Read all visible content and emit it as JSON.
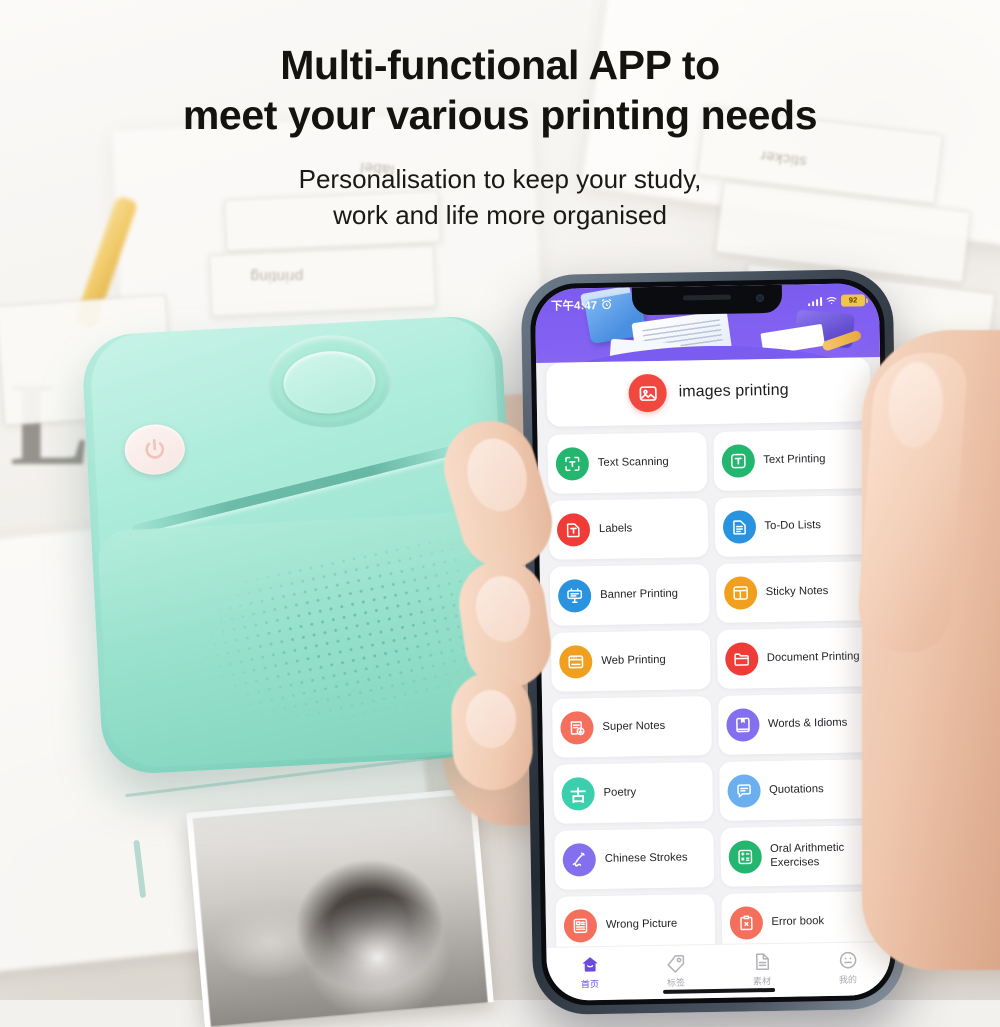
{
  "headline": {
    "line1": "Multi-functional APP to",
    "line2": "meet your various printing needs",
    "sub1": "Personalisation to keep your study,",
    "sub2": "work and life more organised"
  },
  "phone": {
    "statusbar": {
      "time": "下午4:47",
      "alarm_icon": "alarm-icon",
      "signal_icon": "signal-bars-icon",
      "wifi_icon": "wifi-icon",
      "battery_icon": "battery-icon",
      "battery_level": "92"
    },
    "featured": {
      "label": "images printing",
      "icon": "image-printing-icon",
      "color": "#f0483f"
    },
    "grid": [
      {
        "label": "Text Scanning",
        "icon": "text-scan-icon",
        "color": "#24b56e"
      },
      {
        "label": "Text Printing",
        "icon": "text-print-icon",
        "color": "#24b56e"
      },
      {
        "label": "Labels",
        "icon": "label-tag-icon",
        "color": "#ef3c36"
      },
      {
        "label": "To-Do Lists",
        "icon": "todo-doc-icon",
        "color": "#2a93e0"
      },
      {
        "label": "Banner Printing",
        "icon": "banner-sign-icon",
        "color": "#2a93e0"
      },
      {
        "label": "Sticky Notes",
        "icon": "sticky-notes-icon",
        "color": "#f0a01e"
      },
      {
        "label": "Web Printing",
        "icon": "browser-window-icon",
        "color": "#f0a01e"
      },
      {
        "label": "Document Printing",
        "icon": "folder-icon",
        "color": "#ef3c36"
      },
      {
        "label": "Super Notes",
        "icon": "note-download-icon",
        "color": "#f4705c"
      },
      {
        "label": "Words & Idioms",
        "icon": "book-icon",
        "color": "#8470ee"
      },
      {
        "label": "Poetry",
        "icon": "poetry-gu-icon",
        "color": "#3ccfae",
        "glyph": "古"
      },
      {
        "label": "Quotations",
        "icon": "quote-bubble-icon",
        "color": "#6bafef"
      },
      {
        "label": "Chinese Strokes",
        "icon": "brush-stroke-icon",
        "color": "#8470ee"
      },
      {
        "label": "Oral Arithmetic Exercises",
        "icon": "calculator-icon",
        "color": "#24b56e"
      },
      {
        "label": "Wrong Picture",
        "icon": "wrong-picture-icon",
        "color": "#f4705c"
      },
      {
        "label": "Error book",
        "icon": "error-book-icon",
        "color": "#f4705c"
      }
    ],
    "tabs": [
      {
        "label": "首页",
        "icon": "home-icon",
        "active": true
      },
      {
        "label": "标签",
        "icon": "tag-icon",
        "active": false
      },
      {
        "label": "素材",
        "icon": "material-icon",
        "active": false
      },
      {
        "label": "我的",
        "icon": "profile-icon",
        "active": false
      }
    ]
  },
  "product": {
    "device_name": "pocket-thermal-printer",
    "device_color": "#9ae2cd",
    "power_button_icon": "power-icon"
  }
}
